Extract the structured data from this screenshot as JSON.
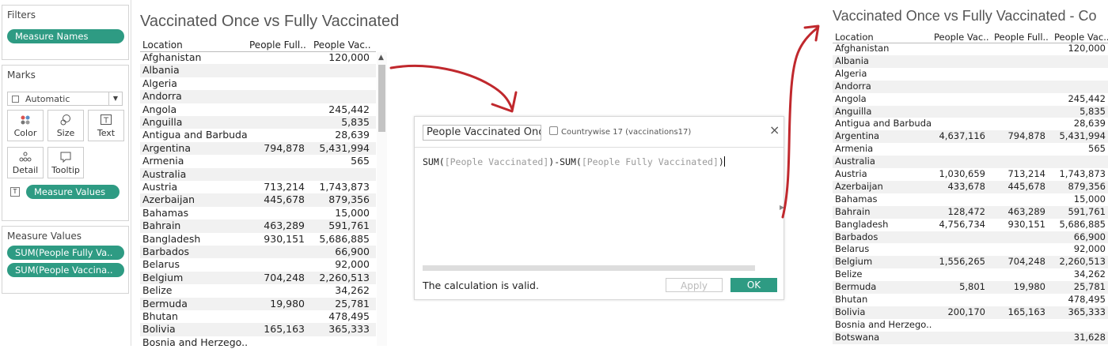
{
  "filters": {
    "title": "Filters",
    "pill": "Measure Names"
  },
  "marks": {
    "title": "Marks",
    "type_select": "Automatic",
    "cards": [
      {
        "label": "Color",
        "icon": "color-icon"
      },
      {
        "label": "Size",
        "icon": "size-icon"
      },
      {
        "label": "Text",
        "icon": "text-icon"
      },
      {
        "label": "Detail",
        "icon": "detail-icon"
      },
      {
        "label": "Tooltip",
        "icon": "tooltip-icon"
      }
    ],
    "text_pill": "Measure Values"
  },
  "measure_values": {
    "title": "Measure Values",
    "pills": [
      "SUM(People Fully Va..",
      "SUM(People Vaccina.."
    ]
  },
  "left_table": {
    "title": "Vaccinated Once vs Fully Vaccinated",
    "headers": [
      "Location",
      "People Full..",
      "People Vac.."
    ],
    "rows": [
      [
        "Afghanistan",
        "",
        "120,000"
      ],
      [
        "Albania",
        "",
        ""
      ],
      [
        "Algeria",
        "",
        ""
      ],
      [
        "Andorra",
        "",
        ""
      ],
      [
        "Angola",
        "",
        "245,442"
      ],
      [
        "Anguilla",
        "",
        "5,835"
      ],
      [
        "Antigua and Barbuda",
        "",
        "28,639"
      ],
      [
        "Argentina",
        "794,878",
        "5,431,994"
      ],
      [
        "Armenia",
        "",
        "565"
      ],
      [
        "Australia",
        "",
        ""
      ],
      [
        "Austria",
        "713,214",
        "1,743,873"
      ],
      [
        "Azerbaijan",
        "445,678",
        "879,356"
      ],
      [
        "Bahamas",
        "",
        "15,000"
      ],
      [
        "Bahrain",
        "463,289",
        "591,761"
      ],
      [
        "Bangladesh",
        "930,151",
        "5,686,885"
      ],
      [
        "Barbados",
        "",
        "66,900"
      ],
      [
        "Belarus",
        "",
        "92,000"
      ],
      [
        "Belgium",
        "704,248",
        "2,260,513"
      ],
      [
        "Belize",
        "",
        "34,262"
      ],
      [
        "Bermuda",
        "19,980",
        "25,781"
      ],
      [
        "Bhutan",
        "",
        "478,495"
      ],
      [
        "Bolivia",
        "165,163",
        "365,333"
      ],
      [
        "Bosnia and Herzego..",
        "",
        ""
      ]
    ]
  },
  "dialog": {
    "calc_name": "People Vaccinated Once",
    "data_source": "Countrywise 17 (vaccinations17)",
    "formula_parts": [
      "SUM(",
      "[People Vaccinated]",
      ")-SUM(",
      "[People Fully Vaccinated]",
      ")"
    ],
    "status": "The calculation is valid.",
    "apply": "Apply",
    "ok": "OK",
    "close": "×"
  },
  "right_table": {
    "title": "Vaccinated Once vs Fully Vaccinated - Co",
    "headers": [
      "Location",
      "People Vac..",
      "People Full..",
      "People Vac.."
    ],
    "rows": [
      [
        "Afghanistan",
        "",
        "",
        "120,000"
      ],
      [
        "Albania",
        "",
        "",
        ""
      ],
      [
        "Algeria",
        "",
        "",
        ""
      ],
      [
        "Andorra",
        "",
        "",
        ""
      ],
      [
        "Angola",
        "",
        "",
        "245,442"
      ],
      [
        "Anguilla",
        "",
        "",
        "5,835"
      ],
      [
        "Antigua and Barbuda",
        "",
        "",
        "28,639"
      ],
      [
        "Argentina",
        "4,637,116",
        "794,878",
        "5,431,994"
      ],
      [
        "Armenia",
        "",
        "",
        "565"
      ],
      [
        "Australia",
        "",
        "",
        ""
      ],
      [
        "Austria",
        "1,030,659",
        "713,214",
        "1,743,873"
      ],
      [
        "Azerbaijan",
        "433,678",
        "445,678",
        "879,356"
      ],
      [
        "Bahamas",
        "",
        "",
        "15,000"
      ],
      [
        "Bahrain",
        "128,472",
        "463,289",
        "591,761"
      ],
      [
        "Bangladesh",
        "4,756,734",
        "930,151",
        "5,686,885"
      ],
      [
        "Barbados",
        "",
        "",
        "66,900"
      ],
      [
        "Belarus",
        "",
        "",
        "92,000"
      ],
      [
        "Belgium",
        "1,556,265",
        "704,248",
        "2,260,513"
      ],
      [
        "Belize",
        "",
        "",
        "34,262"
      ],
      [
        "Bermuda",
        "5,801",
        "19,980",
        "25,781"
      ],
      [
        "Bhutan",
        "",
        "",
        "478,495"
      ],
      [
        "Bolivia",
        "200,170",
        "165,163",
        "365,333"
      ],
      [
        "Bosnia and Herzego..",
        "",
        "",
        ""
      ],
      [
        "Botswana",
        "",
        "",
        "31,628"
      ]
    ]
  },
  "colors": {
    "pill": "#2e9b83",
    "arrow": "#c0282d",
    "ok_button": "#2e9b83"
  }
}
